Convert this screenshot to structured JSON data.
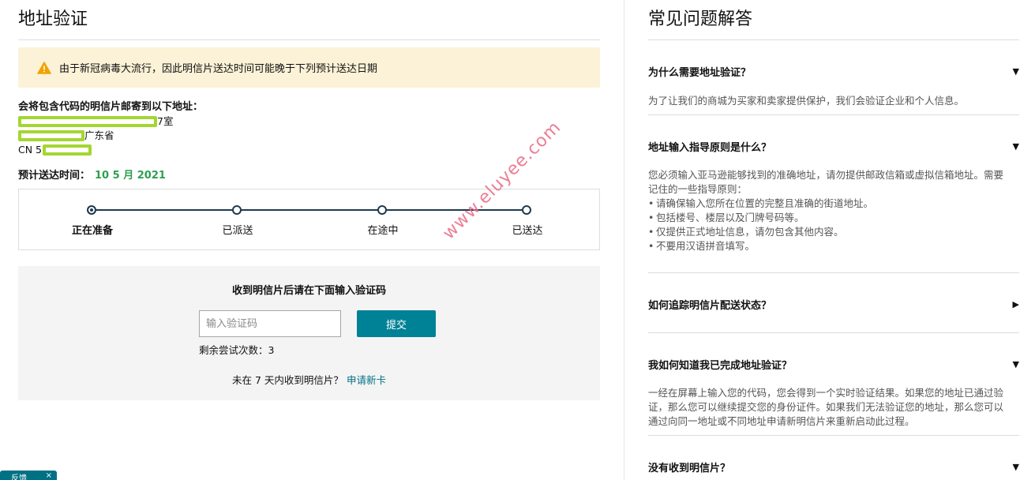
{
  "address_verification": {
    "title": "地址验证",
    "alert": "由于新冠病毒大流行，因此明信片送达时间可能晚于下列预计送达日期",
    "address_heading": "会将包含代码的明信片邮寄到以下地址：",
    "address_line1_suffix": "7室",
    "address_line2_suffix": "广东省",
    "address_line3_prefix": "CN 5",
    "eta_label": "预计送达时间：",
    "eta_value": "10 5 月 2021",
    "steps": [
      "正在准备",
      "已派送",
      "在途中",
      "已送达"
    ],
    "active_step": 0,
    "verify_prompt": "收到明信片后请在下面输入验证码",
    "code_placeholder": "输入验证码",
    "submit_label": "提交",
    "attempts_text": "剩余尝试次数：3",
    "not_received_text": "未在 7 天内收到明信片？",
    "request_new_link": "申请新卡"
  },
  "faq": {
    "title": "常见问题解答",
    "items": [
      {
        "question": "为什么需要地址验证？",
        "expanded": true,
        "answer": "为了让我们的商城为买家和卖家提供保护，我们会验证企业和个人信息。"
      },
      {
        "question": "地址输入指导原则是什么？",
        "expanded": true,
        "answer_lines": [
          "您必须输入亚马逊能够找到的准确地址，请勿提供邮政信箱或虚拟信箱地址。需要",
          "记住的一些指导原则："
        ],
        "bullets": [
          "请确保输入您所在位置的完整且准确的街道地址。",
          "包括楼号、楼层以及门牌号码等。",
          "仅提供正式地址信息，请勿包含其他内容。",
          "不要用汉语拼音填写。"
        ]
      },
      {
        "question": "如何追踪明信片配送状态？",
        "expanded": false
      },
      {
        "question": "我如何知道我已完成地址验证？",
        "expanded": true,
        "answer_lines": [
          "一经在屏幕上输入您的代码，您会得到一个实时验证结果。如果您的地址已通过验",
          "证，那么您可以继续提交您的身份证件。如果我们无法验证您的地址，那么您可以",
          "通过向同一地址或不同地址申请新明信片来重新启动此过程。"
        ]
      },
      {
        "question": "没有收到明信片？",
        "expanded": true
      }
    ],
    "caret_expanded": "▼",
    "caret_collapsed": "▶"
  },
  "watermark": "www.eluyee.com",
  "feedback_tab": {
    "label": "反馈",
    "close": "×"
  },
  "colors": {
    "alert_bg": "#fcf2d7",
    "accent_teal": "#008296",
    "eta_green": "#2e9e4f",
    "redaction": "#a4d632",
    "watermark": "#e8728c"
  }
}
